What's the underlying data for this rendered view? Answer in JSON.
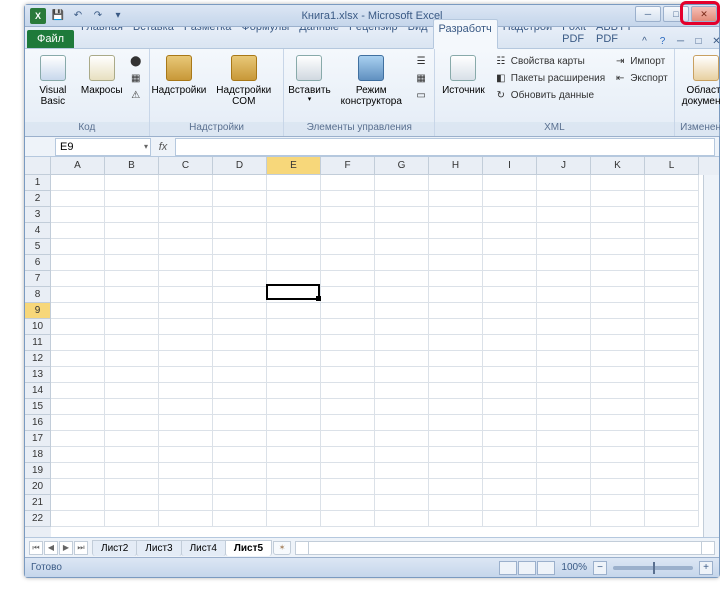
{
  "titlebar": {
    "doc": "Книга1.xlsx",
    "app": "Microsoft Excel"
  },
  "ribbon": {
    "file": "Файл",
    "tabs": [
      "Главная",
      "Вставка",
      "Разметка",
      "Формулы",
      "Данные",
      "Рецензир",
      "Вид",
      "Разработч",
      "Надстрой",
      "Foxit PDF",
      "ABBYY PDF"
    ],
    "active_index": 7,
    "groups": {
      "code": {
        "label": "Код",
        "vb": "Visual Basic",
        "macros": "Макросы"
      },
      "addins": {
        "label": "Надстройки",
        "addins": "Надстройки",
        "com": "Надстройки COM"
      },
      "controls": {
        "label": "Элементы управления",
        "insert": "Вставить",
        "design": "Режим конструктора"
      },
      "xml": {
        "label": "XML",
        "source": "Источник",
        "mapprops": "Свойства карты",
        "extpacks": "Пакеты расширения",
        "refresh": "Обновить данные",
        "import": "Импорт",
        "export": "Экспорт"
      },
      "modify": {
        "label": "Изменение",
        "docpanel": "Область документа"
      }
    }
  },
  "formula": {
    "namebox": "E9",
    "fx": "fx"
  },
  "grid": {
    "cols": [
      "A",
      "B",
      "C",
      "D",
      "E",
      "F",
      "G",
      "H",
      "I",
      "J",
      "K",
      "L"
    ],
    "rows": 22,
    "sel_col": 4,
    "sel_row": 8
  },
  "sheets": {
    "tabs": [
      "Лист2",
      "Лист3",
      "Лист4",
      "Лист5"
    ],
    "active_index": 3
  },
  "status": {
    "ready": "Готово",
    "zoom": "100%"
  }
}
